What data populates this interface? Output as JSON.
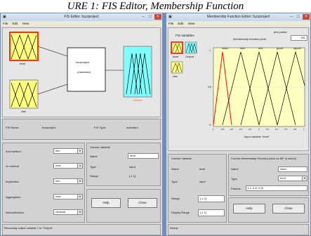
{
  "caption": "URE 1: FIS Editor, Membership Function",
  "fis_window": {
    "title": "FIS Editor: fuzzproject",
    "menu": [
      "File",
      "Edit",
      "View"
    ],
    "inputs": [
      "level",
      "rate"
    ],
    "center_box": {
      "name": "fuzzproject",
      "kind": "(mamdani)"
    },
    "output": "Output",
    "info": {
      "fis_name_label": "FIS Name:",
      "fis_name": "fuzzproject",
      "fis_type_label": "FIS Type:",
      "fis_type": "mamdani"
    },
    "methods": [
      {
        "label": "And method",
        "value": "min"
      },
      {
        "label": "Or method",
        "value": "max"
      },
      {
        "label": "Implication",
        "value": "min"
      },
      {
        "label": "Aggregation",
        "value": "max"
      },
      {
        "label": "Defuzzification",
        "value": "centroid"
      }
    ],
    "current_variable": {
      "heading": "Current Variable",
      "name_label": "Name",
      "name": "level",
      "type_label": "Type",
      "type": "input",
      "range_label": "Range",
      "range": "[-1 1]"
    },
    "help_label": "Help",
    "close_label": "Close",
    "status": "Renaming output variable 1 to \"Output\""
  },
  "mf_window": {
    "title": "Membership Function Editor: fuzzproject",
    "menu": [
      "File",
      "Edit",
      "View"
    ],
    "fis_variables_label": "FIS Variables",
    "variables": [
      "level",
      "Output",
      "rate"
    ],
    "plot_points_label": "plot points:",
    "plot_points": "181",
    "plot_title": "Membership function plots",
    "mf_names": [
      "vbad",
      "bad",
      "ave",
      "good",
      "vgood"
    ],
    "axis_label": "input variable \"level\"",
    "ticks": [
      "-1",
      "-0.8",
      "-0.6",
      "-0.4",
      "-0.2",
      "0",
      "0.2",
      "0.4",
      "0.6",
      "0.8",
      "1"
    ],
    "y_ticks": [
      "1",
      "0.5",
      "0"
    ],
    "current_variable": {
      "heading": "Current Variable",
      "name_label": "Name",
      "name": "level",
      "type_label": "Type",
      "type": "input",
      "range_label": "Range",
      "range": "[-1 1]",
      "display_label": "Display Range",
      "display": "[-1 1]"
    },
    "current_mf": {
      "heading": "Current Membership Function (click on MF to select)",
      "name_label": "Name",
      "name": "vbad",
      "type_label": "Type",
      "type": "trimf",
      "params_label": "Params",
      "params": "[-1 -0.8 -0.6]"
    },
    "help_label": "Help",
    "close_label": "Close",
    "status": "Ready"
  },
  "colors": {
    "input_box": "#ffff80",
    "output_box": "#80ffff",
    "selected_border": "#ff0000",
    "plot_bg": "#ffffc0"
  }
}
